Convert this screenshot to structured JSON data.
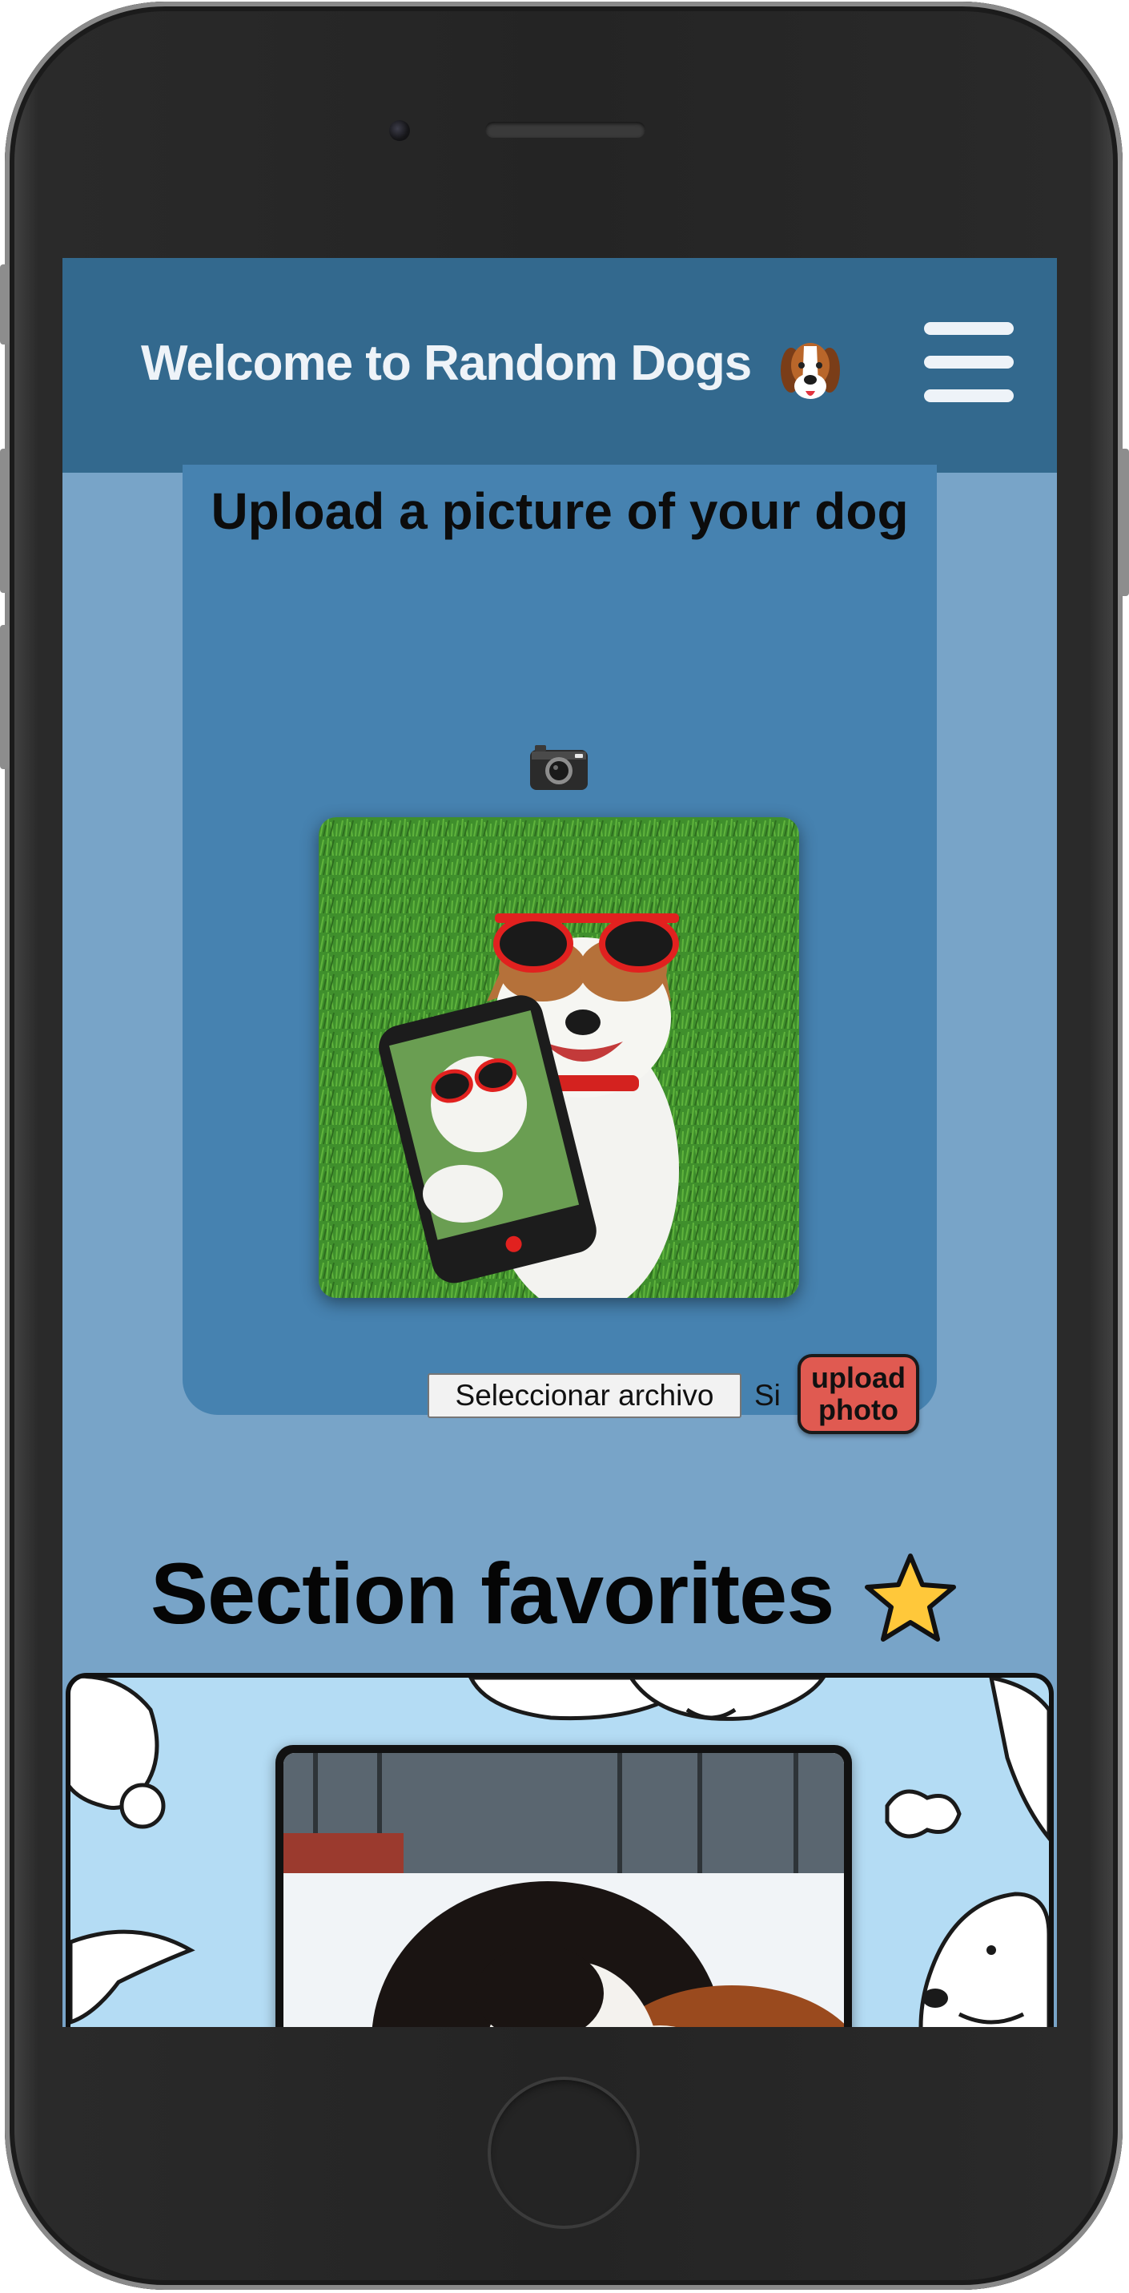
{
  "navbar": {
    "title": "Welcome to Random Dogs",
    "title_icon": "beagle-dog-face-icon",
    "menu_icon": "hamburger-menu-icon"
  },
  "upload": {
    "title": "Upload a picture of your dog",
    "title_icon": "camera-icon",
    "photo": "dog-with-sunglasses-taking-selfie",
    "file_button_label": "Seleccionar archivo",
    "file_status": "Si",
    "upload_button_line1": "upload",
    "upload_button_line2": "photo"
  },
  "favorites": {
    "title": "Section favorites",
    "title_icon": "star-icon",
    "photo": "saint-bernard-in-snow"
  },
  "colors": {
    "navbar_bg": "#33698e",
    "page_bg": "#78a4c8",
    "card_bg": "#4682b0",
    "upload_button_bg": "#e05a51",
    "favorites_bg": "#b4dcf4"
  }
}
